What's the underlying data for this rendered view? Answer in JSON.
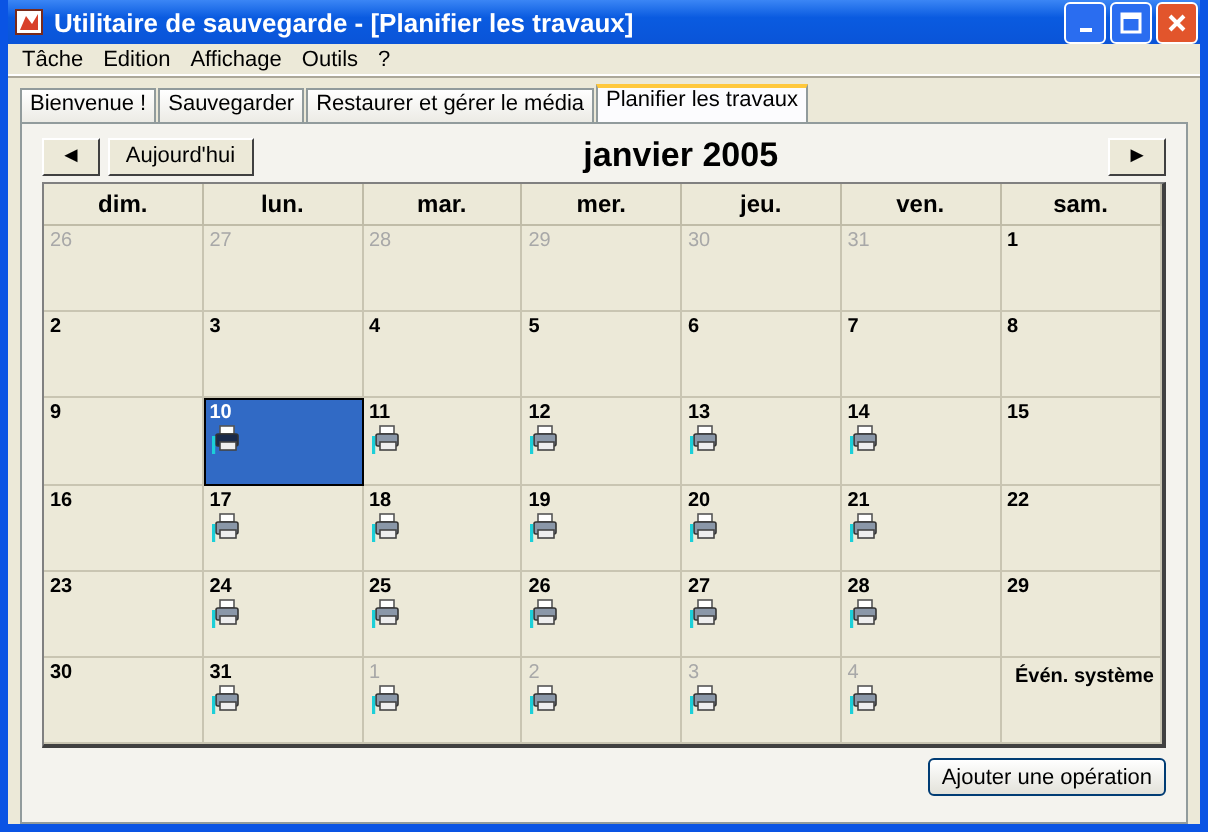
{
  "window": {
    "title": "Utilitaire de sauvegarde - [Planifier les travaux]"
  },
  "menu": [
    "Tâche",
    "Edition",
    "Affichage",
    "Outils",
    "?"
  ],
  "tabs": [
    {
      "label": "Bienvenue !",
      "selected": false
    },
    {
      "label": "Sauvegarder",
      "selected": false
    },
    {
      "label": "Restaurer et gérer le média",
      "selected": false
    },
    {
      "label": "Planifier les travaux",
      "selected": true
    }
  ],
  "calendar": {
    "prev": "◄",
    "today": "Aujourd'hui",
    "month": "janvier 2005",
    "next": "►",
    "weekdays": [
      "dim.",
      "lun.",
      "mar.",
      "mer.",
      "jeu.",
      "ven.",
      "sam."
    ],
    "cells": [
      {
        "kind": "day",
        "day": "26",
        "other_month": true,
        "job": false,
        "selected": false
      },
      {
        "kind": "day",
        "day": "27",
        "other_month": true,
        "job": false,
        "selected": false
      },
      {
        "kind": "day",
        "day": "28",
        "other_month": true,
        "job": false,
        "selected": false
      },
      {
        "kind": "day",
        "day": "29",
        "other_month": true,
        "job": false,
        "selected": false
      },
      {
        "kind": "day",
        "day": "30",
        "other_month": true,
        "job": false,
        "selected": false
      },
      {
        "kind": "day",
        "day": "31",
        "other_month": true,
        "job": false,
        "selected": false
      },
      {
        "kind": "day",
        "day": "1",
        "other_month": false,
        "job": false,
        "selected": false
      },
      {
        "kind": "day",
        "day": "2",
        "other_month": false,
        "job": false,
        "selected": false
      },
      {
        "kind": "day",
        "day": "3",
        "other_month": false,
        "job": false,
        "selected": false
      },
      {
        "kind": "day",
        "day": "4",
        "other_month": false,
        "job": false,
        "selected": false
      },
      {
        "kind": "day",
        "day": "5",
        "other_month": false,
        "job": false,
        "selected": false
      },
      {
        "kind": "day",
        "day": "6",
        "other_month": false,
        "job": false,
        "selected": false
      },
      {
        "kind": "day",
        "day": "7",
        "other_month": false,
        "job": false,
        "selected": false
      },
      {
        "kind": "day",
        "day": "8",
        "other_month": false,
        "job": false,
        "selected": false
      },
      {
        "kind": "day",
        "day": "9",
        "other_month": false,
        "job": false,
        "selected": false
      },
      {
        "kind": "day",
        "day": "10",
        "other_month": false,
        "job": true,
        "selected": true
      },
      {
        "kind": "day",
        "day": "11",
        "other_month": false,
        "job": true,
        "selected": false
      },
      {
        "kind": "day",
        "day": "12",
        "other_month": false,
        "job": true,
        "selected": false
      },
      {
        "kind": "day",
        "day": "13",
        "other_month": false,
        "job": true,
        "selected": false
      },
      {
        "kind": "day",
        "day": "14",
        "other_month": false,
        "job": true,
        "selected": false
      },
      {
        "kind": "day",
        "day": "15",
        "other_month": false,
        "job": false,
        "selected": false
      },
      {
        "kind": "day",
        "day": "16",
        "other_month": false,
        "job": false,
        "selected": false
      },
      {
        "kind": "day",
        "day": "17",
        "other_month": false,
        "job": true,
        "selected": false
      },
      {
        "kind": "day",
        "day": "18",
        "other_month": false,
        "job": true,
        "selected": false
      },
      {
        "kind": "day",
        "day": "19",
        "other_month": false,
        "job": true,
        "selected": false
      },
      {
        "kind": "day",
        "day": "20",
        "other_month": false,
        "job": true,
        "selected": false
      },
      {
        "kind": "day",
        "day": "21",
        "other_month": false,
        "job": true,
        "selected": false
      },
      {
        "kind": "day",
        "day": "22",
        "other_month": false,
        "job": false,
        "selected": false
      },
      {
        "kind": "day",
        "day": "23",
        "other_month": false,
        "job": false,
        "selected": false
      },
      {
        "kind": "day",
        "day": "24",
        "other_month": false,
        "job": true,
        "selected": false
      },
      {
        "kind": "day",
        "day": "25",
        "other_month": false,
        "job": true,
        "selected": false
      },
      {
        "kind": "day",
        "day": "26",
        "other_month": false,
        "job": true,
        "selected": false
      },
      {
        "kind": "day",
        "day": "27",
        "other_month": false,
        "job": true,
        "selected": false
      },
      {
        "kind": "day",
        "day": "28",
        "other_month": false,
        "job": true,
        "selected": false
      },
      {
        "kind": "day",
        "day": "29",
        "other_month": false,
        "job": false,
        "selected": false
      },
      {
        "kind": "day",
        "day": "30",
        "other_month": false,
        "job": false,
        "selected": false
      },
      {
        "kind": "day",
        "day": "31",
        "other_month": false,
        "job": true,
        "selected": false
      },
      {
        "kind": "day",
        "day": "1",
        "other_month": true,
        "job": true,
        "selected": false
      },
      {
        "kind": "day",
        "day": "2",
        "other_month": true,
        "job": true,
        "selected": false
      },
      {
        "kind": "day",
        "day": "3",
        "other_month": true,
        "job": true,
        "selected": false
      },
      {
        "kind": "day",
        "day": "4",
        "other_month": true,
        "job": true,
        "selected": false
      },
      {
        "kind": "event",
        "text": "Évén. système"
      }
    ]
  },
  "add_button": "Ajouter une opération"
}
